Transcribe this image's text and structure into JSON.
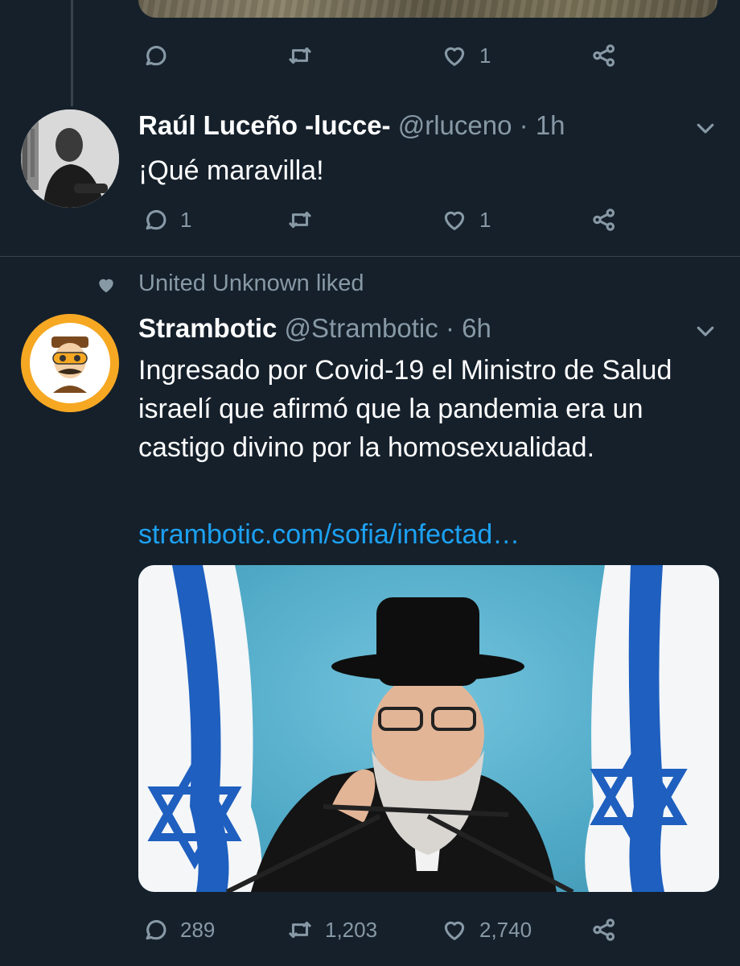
{
  "top_tweet": {
    "actions": {
      "reply_count": "",
      "retweet_count": "",
      "like_count": "1"
    }
  },
  "reply": {
    "name": "Raúl Luceño -lucce-",
    "handle": "@rluceno",
    "separator": "·",
    "time": "1h",
    "text": "¡Qué maravilla!",
    "actions": {
      "reply_count": "1",
      "retweet_count": "",
      "like_count": "1"
    }
  },
  "liked_tweet": {
    "social_context": "United Unknown liked",
    "name": "Strambotic",
    "handle": "@Strambotic",
    "separator": "·",
    "time": "6h",
    "text": "Ingresado por Covid-19 el Ministro de Salud israelí que afirmó que la pandemia era un castigo divino por la homosexualidad.",
    "link": "strambotic.com/sofia/infectad…",
    "actions": {
      "reply_count": "289",
      "retweet_count": "1,203",
      "like_count": "2,740"
    }
  },
  "icons": {
    "reply": "reply-icon",
    "retweet": "retweet-icon",
    "like": "heart-icon",
    "share": "share-icon",
    "more": "chevron-down-icon"
  },
  "colors": {
    "background": "#15202b",
    "secondary_text": "#8899a6",
    "link": "#1da1f2",
    "divider": "#38444d"
  }
}
